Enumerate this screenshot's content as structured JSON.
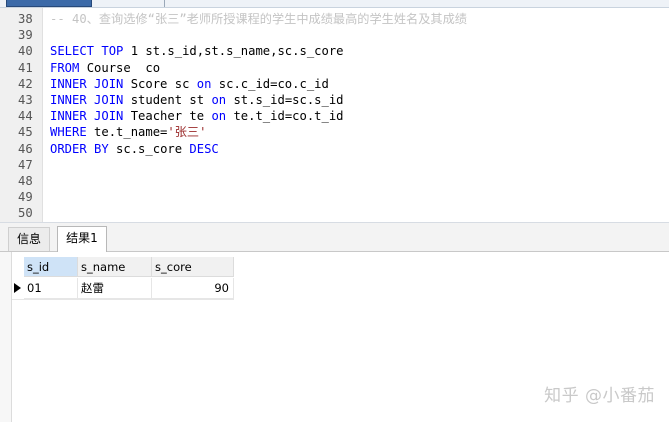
{
  "editor": {
    "lines": [
      {
        "no": "38",
        "parts": [
          {
            "t": "-- 40、查询选修“张三”老师所授课程的学生中成绩最高的学生姓名及其成绩",
            "c": "cmt"
          }
        ]
      },
      {
        "no": "39",
        "parts": []
      },
      {
        "no": "40",
        "parts": [
          {
            "t": "SELECT TOP ",
            "c": "kw"
          },
          {
            "t": "1",
            "c": "num"
          },
          {
            "t": " st.s_id,st.s_name,sc.s_core",
            "c": ""
          }
        ]
      },
      {
        "no": "41",
        "parts": [
          {
            "t": "FROM",
            "c": "kw"
          },
          {
            "t": " Course  co",
            "c": ""
          }
        ]
      },
      {
        "no": "42",
        "parts": [
          {
            "t": "INNER JOIN",
            "c": "kw"
          },
          {
            "t": " Score sc ",
            "c": ""
          },
          {
            "t": "on",
            "c": "kw"
          },
          {
            "t": " sc.c_id=co.c_id",
            "c": ""
          }
        ]
      },
      {
        "no": "43",
        "parts": [
          {
            "t": "INNER JOIN",
            "c": "kw"
          },
          {
            "t": " student st ",
            "c": ""
          },
          {
            "t": "on",
            "c": "kw"
          },
          {
            "t": " st.s_id=sc.s_id",
            "c": ""
          }
        ]
      },
      {
        "no": "44",
        "parts": [
          {
            "t": "INNER JOIN",
            "c": "kw"
          },
          {
            "t": " Teacher te ",
            "c": ""
          },
          {
            "t": "on",
            "c": "kw"
          },
          {
            "t": " te.t_id=co.t_id",
            "c": ""
          }
        ]
      },
      {
        "no": "45",
        "parts": [
          {
            "t": "WHERE",
            "c": "kw"
          },
          {
            "t": " te.t_name=",
            "c": ""
          },
          {
            "t": "'张三'",
            "c": "str"
          }
        ]
      },
      {
        "no": "46",
        "parts": [
          {
            "t": "ORDER BY",
            "c": "kw"
          },
          {
            "t": " sc.s_core ",
            "c": ""
          },
          {
            "t": "DESC",
            "c": "kw"
          }
        ]
      },
      {
        "no": "47",
        "parts": []
      },
      {
        "no": "48",
        "parts": []
      },
      {
        "no": "49",
        "parts": []
      },
      {
        "no": "50",
        "parts": []
      }
    ]
  },
  "result_tabs": {
    "info": "信息",
    "result": "结果1"
  },
  "grid": {
    "columns": [
      "s_id",
      "s_name",
      "s_core"
    ],
    "rows": [
      [
        "01",
        "赵雷",
        "90"
      ]
    ]
  },
  "watermark": "知乎 @小番茄",
  "colors": {
    "keyword": "#0000ff",
    "comment": "#c4c4c4",
    "string": "#9a2a2a",
    "selected_header": "#cfe3f7"
  }
}
